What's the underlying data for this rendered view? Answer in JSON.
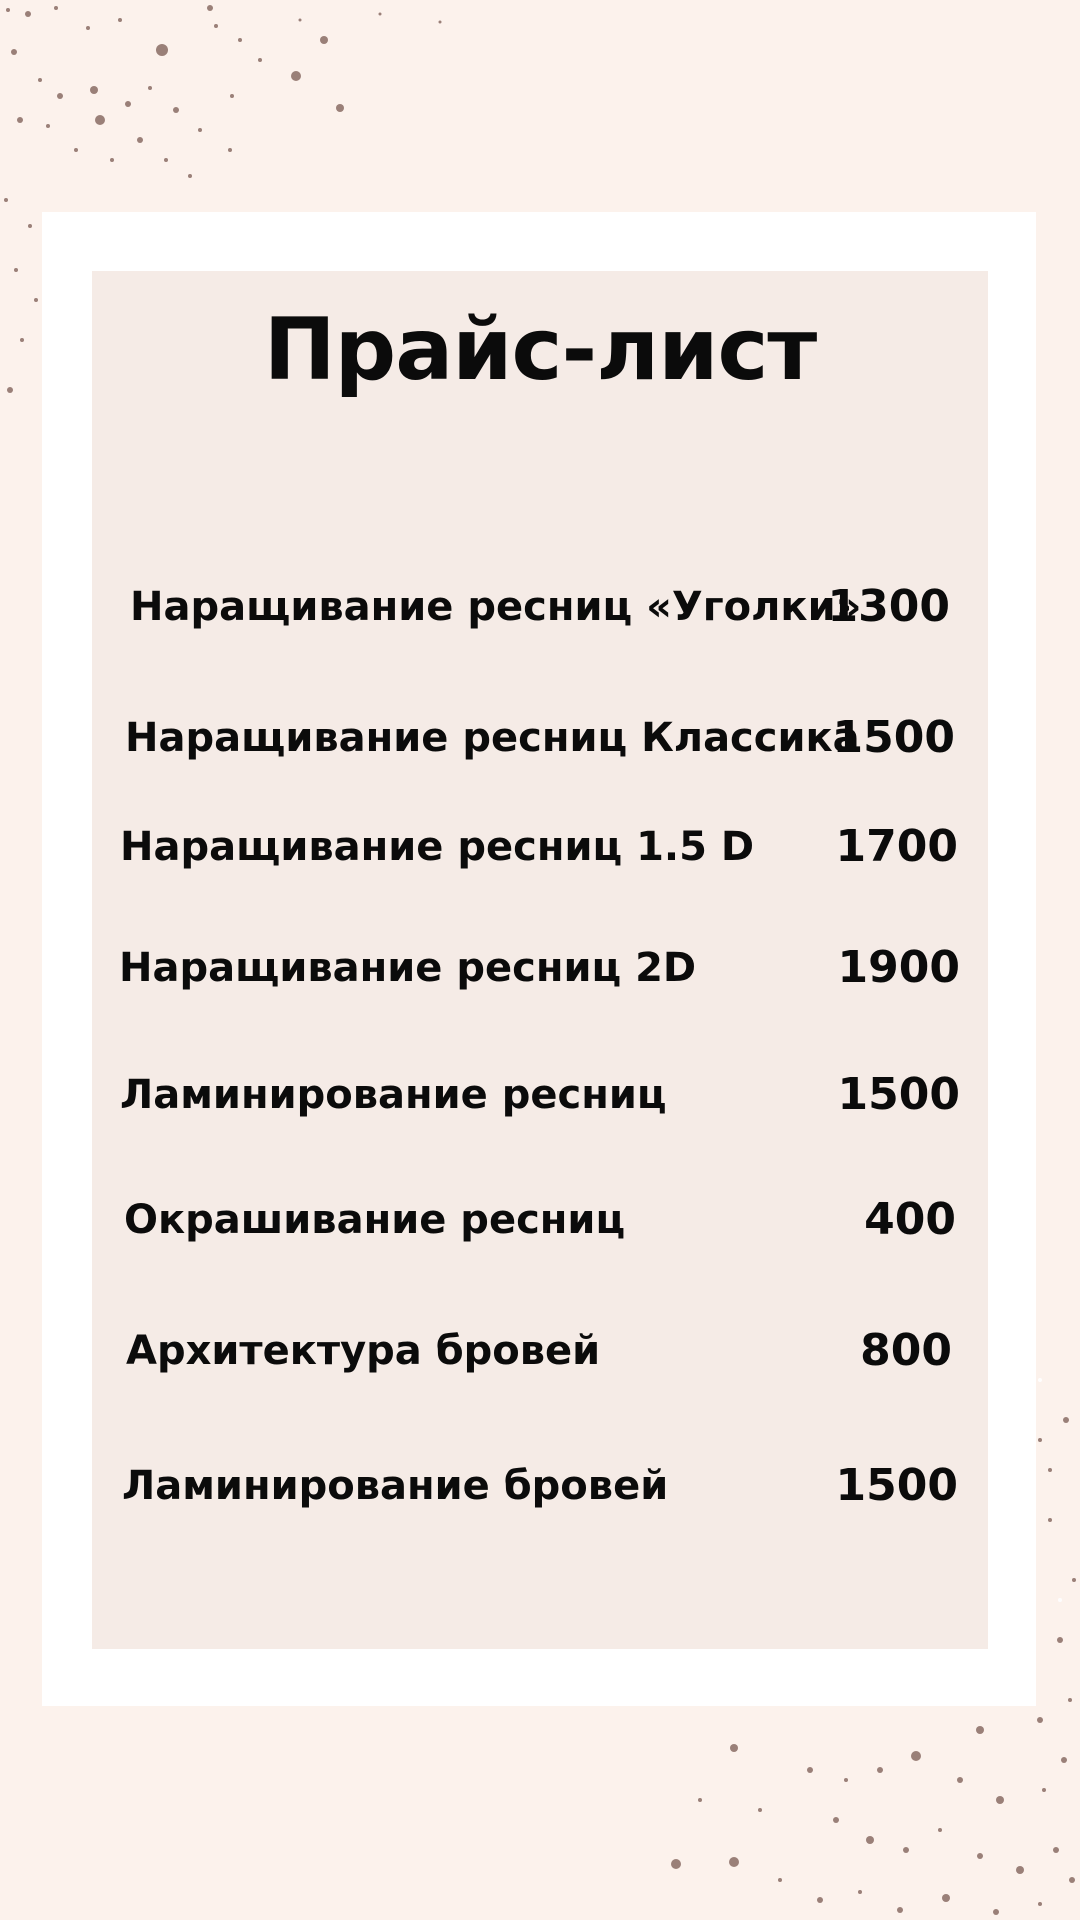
{
  "title": "Прайс-лист",
  "items": [
    {
      "name": "Наращивание ресниц «Уголки»",
      "price": "1300"
    },
    {
      "name": "Наращивание ресниц Классика",
      "price": "1500"
    },
    {
      "name": "Наращивание ресниц 1.5 D",
      "price": "1700"
    },
    {
      "name": "Наращивание ресниц 2D",
      "price": "1900"
    },
    {
      "name": "Ламинирование ресниц",
      "price": "1500"
    },
    {
      "name": "Окрашивание ресниц",
      "price": "400"
    },
    {
      "name": "Архитектура бровей",
      "price": "800"
    },
    {
      "name": "Ламинирование бровей",
      "price": "1500"
    }
  ],
  "colors": {
    "background": "#fcf2ec",
    "frame": "#ffffff",
    "panel": "#f5ebe6",
    "text": "#0b0b0b",
    "speckle": "#7a5a52"
  }
}
